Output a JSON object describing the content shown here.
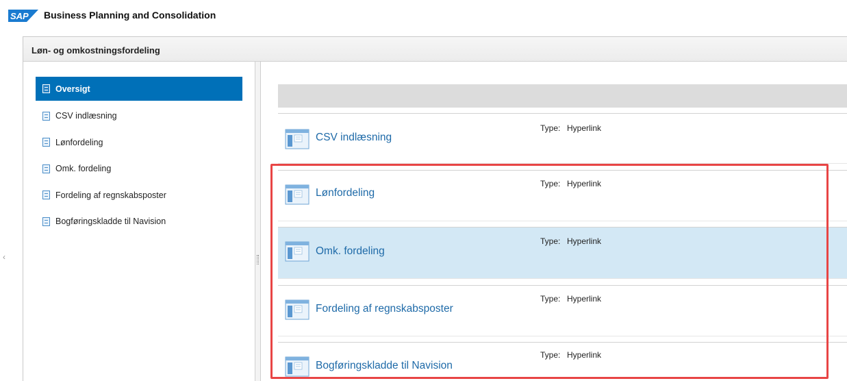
{
  "app": {
    "logo_text": "SAP",
    "title": "Business Planning and Consolidation"
  },
  "workbook": {
    "title": "Løn- og omkostningsfordeling"
  },
  "nav": {
    "items": [
      {
        "label": "Oversigt",
        "icon": "overview-icon",
        "active": true
      },
      {
        "label": "CSV indlæsning",
        "icon": "document-icon",
        "active": false
      },
      {
        "label": "Lønfordeling",
        "icon": "document-icon",
        "active": false
      },
      {
        "label": "Omk. fordeling",
        "icon": "document-icon",
        "active": false
      },
      {
        "label": "Fordeling af regnskabsposter",
        "icon": "document-icon",
        "active": false
      },
      {
        "label": "Bogføringskladde til Navision",
        "icon": "document-icon",
        "active": false
      }
    ]
  },
  "content": {
    "type_label": "Type:",
    "rows": [
      {
        "label": "CSV indlæsning",
        "type": "Hyperlink",
        "selected": false
      },
      {
        "label": "Lønfordeling",
        "type": "Hyperlink",
        "selected": false
      },
      {
        "label": "Omk. fordeling",
        "type": "Hyperlink",
        "selected": true
      },
      {
        "label": "Fordeling af regnskabsposter",
        "type": "Hyperlink",
        "selected": false
      },
      {
        "label": "Bogføringskladde til Navision",
        "type": "Hyperlink",
        "selected": false
      }
    ]
  },
  "colors": {
    "brand_blue": "#0070b8",
    "link_blue": "#1e6aa8",
    "selected_row": "#d3e8f5",
    "highlight_red": "#e84545"
  }
}
